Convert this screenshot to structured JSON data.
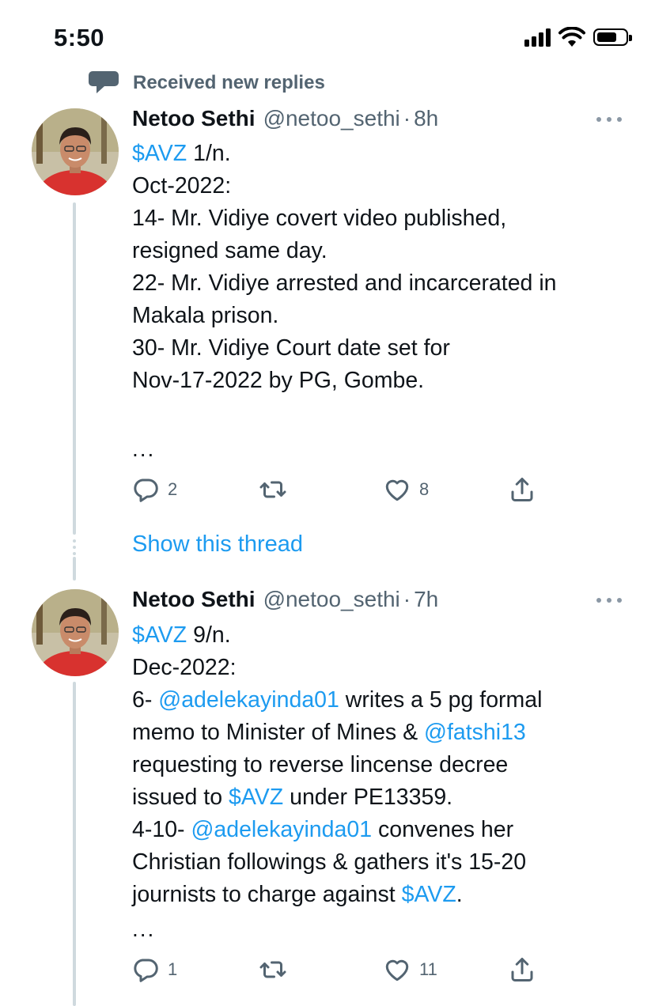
{
  "status_bar": {
    "time": "5:50",
    "icons": [
      "signal-icon",
      "wifi-icon",
      "battery-icon"
    ]
  },
  "social_context": {
    "icon": "reply-bubble-icon",
    "text": "Received new replies"
  },
  "tweets": [
    {
      "author": {
        "name": "Netoo Sethi",
        "handle": "@netoo_sethi",
        "time": "8h"
      },
      "dot": "·",
      "lines": {
        "l1_cashtag": "$AVZ",
        "l1_text": " 1/n.",
        "l2": "Oct-2022:",
        "l3": "14- Mr. Vidiye covert video published,",
        "l4": "resigned same day.",
        "l5": "22- Mr. Vidiye arrested and incarcerated in",
        "l6": "Makala prison.",
        "l7": "30- Mr. Vidiye Court date set for",
        "l8": "Nov-17-2022 by PG, Gombe."
      },
      "ellipsis": "...",
      "replies": "2",
      "retweets": "",
      "likes": "8",
      "show_thread": "Show this thread"
    },
    {
      "author": {
        "name": "Netoo Sethi",
        "handle": "@netoo_sethi",
        "time": "7h"
      },
      "dot": "·",
      "lines": {
        "l1_cashtag": "$AVZ",
        "l1_text": " 9/n.",
        "l2": "Dec-2022:",
        "l3_pre": "6- ",
        "l3_mention": "@adelekayinda01",
        "l3_post": " writes a 5 pg formal",
        "l4_pre": "memo to Minister of Mines & ",
        "l4_mention": "@fatshi13",
        "l5": "requesting to reverse lincense decree",
        "l6_pre": "issued to ",
        "l6_cashtag": "$AVZ",
        "l6_post": " under PE13359.",
        "l7_pre": "4-10- ",
        "l7_mention": "@adelekayinda01",
        "l7_post": " convenes her",
        "l8": "Christian followings & gathers it's 15-20",
        "l9_pre": "journists to charge against ",
        "l9_cashtag": "$AVZ",
        "l9_post": "."
      },
      "ellipsis": "...",
      "replies": "1",
      "retweets": "",
      "likes": "11"
    }
  ],
  "colors": {
    "link": "#1d9bf0",
    "secondary_text": "#536471",
    "thread_line": "#cfd9de",
    "primary_text": "#0f1419"
  }
}
